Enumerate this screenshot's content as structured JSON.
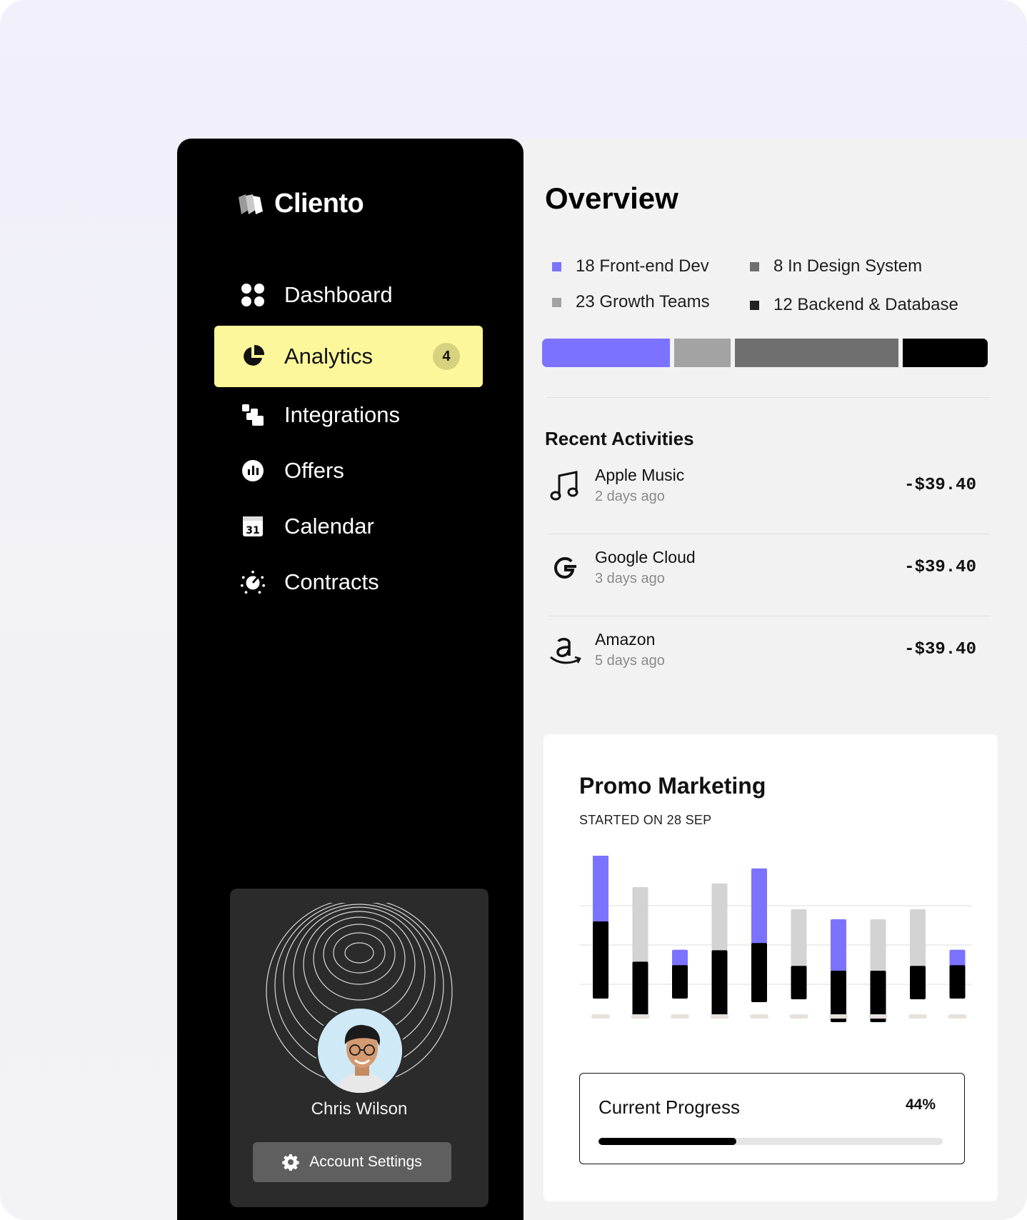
{
  "brand": {
    "name": "Cliento"
  },
  "nav": [
    {
      "id": "dashboard",
      "label": "Dashboard",
      "icon": "dashboard-icon"
    },
    {
      "id": "analytics",
      "label": "Analytics",
      "icon": "pie-chart-icon",
      "active": true,
      "badge": "4"
    },
    {
      "id": "integrations",
      "label": "Integrations",
      "icon": "integrations-icon"
    },
    {
      "id": "offers",
      "label": "Offers",
      "icon": "offers-icon"
    },
    {
      "id": "calendar",
      "label": "Calendar",
      "icon": "calendar-icon",
      "icon_text": "31"
    },
    {
      "id": "contracts",
      "label": "Contracts",
      "icon": "contracts-icon"
    }
  ],
  "profile": {
    "name": "Chris Wilson",
    "account_settings": "Account Settings"
  },
  "overview": {
    "title": "Overview",
    "legend": [
      {
        "label": "18 Front-end Dev",
        "color": "#7b73ff"
      },
      {
        "label": "8 In Design System",
        "color": "#6f6f6f"
      },
      {
        "label": "23 Growth Teams",
        "color": "#a3a3a3"
      },
      {
        "label": "12 Backend & Database",
        "color": "#222222"
      }
    ],
    "segments": [
      {
        "value": 18,
        "color": "#7b73ff"
      },
      {
        "value": 8,
        "color": "#a3a3a3"
      },
      {
        "value": 23,
        "color": "#6f6f6f"
      },
      {
        "value": 12,
        "color": "#000000"
      }
    ]
  },
  "recent_activities": {
    "title": "Recent Activities",
    "items": [
      {
        "name": "Apple Music",
        "time": "2 days ago",
        "amount": "-$39.40",
        "icon": "music-note-icon"
      },
      {
        "name": "Google Cloud",
        "time": "3 days ago",
        "amount": "-$39.40",
        "icon": "google-icon"
      },
      {
        "name": "Amazon",
        "time": "5 days ago",
        "amount": "-$39.40",
        "icon": "amazon-icon"
      }
    ]
  },
  "promo": {
    "title": "Promo Marketing",
    "subtitle": "STARTED ON 28 SEP",
    "chart_data": {
      "type": "bar",
      "categories": [
        "",
        "",
        "",
        "",
        "",
        "",
        "",
        "",
        "",
        ""
      ],
      "series": [
        {
          "values": [
            60,
            42,
            26,
            52,
            46,
            26,
            40,
            40,
            26,
            26
          ],
          "color": "#000000"
        },
        {
          "values": [
            62,
            58,
            12,
            52,
            58,
            44,
            40,
            40,
            44,
            12
          ],
          "color_pattern": [
            "#7b73ff",
            "#d3d3d3",
            "#7b73ff",
            "#d3d3d3",
            "#7b73ff",
            "#d3d3d3",
            "#7b73ff",
            "#d3d3d3",
            "#d3d3d3",
            "#7b73ff"
          ]
        }
      ],
      "baselines": [
        200,
        224,
        200,
        226,
        205,
        201,
        233,
        233,
        201,
        200
      ],
      "grid": true
    },
    "progress": {
      "label": "Current Progress",
      "value_text": "44%",
      "fraction": 0.4
    }
  }
}
